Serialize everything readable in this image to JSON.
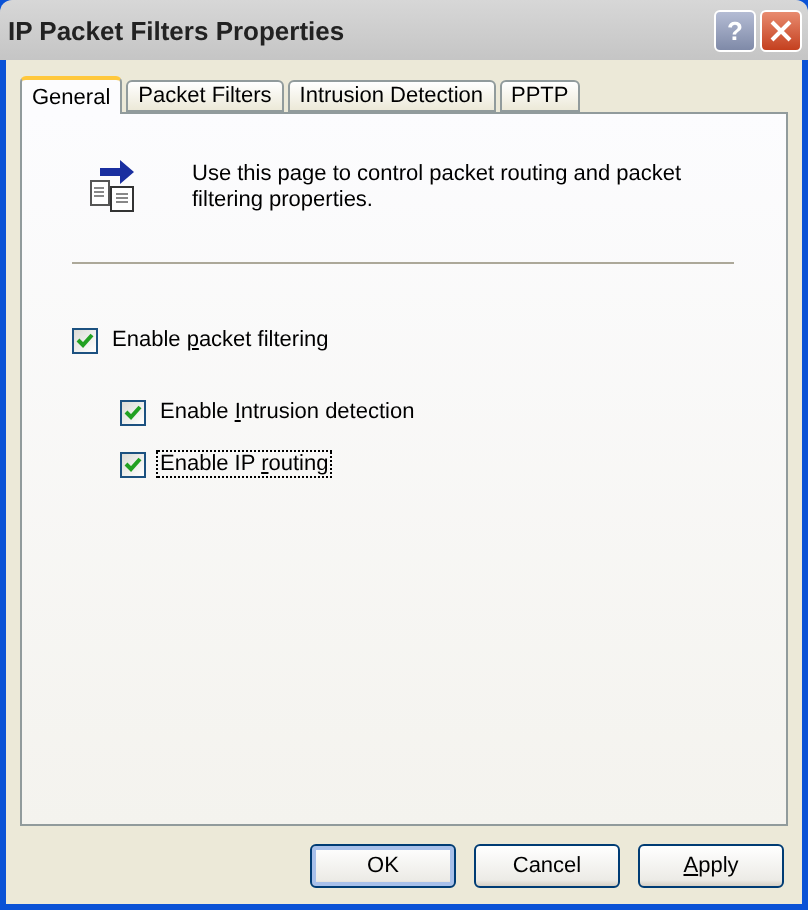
{
  "window": {
    "title": "IP Packet Filters Properties",
    "title_buttons": [
      {
        "kind": "help",
        "label": "?"
      },
      {
        "kind": "close"
      }
    ]
  },
  "tabs": [
    {
      "label": "General",
      "selected": true
    },
    {
      "label": "Packet Filters",
      "selected": false
    },
    {
      "label": "Intrusion Detection",
      "selected": false
    },
    {
      "label": "PPTP",
      "selected": false
    }
  ],
  "description": "Use this page to control packet routing and packet filtering properties.",
  "options": [
    {
      "label": {
        "before": "Enable ",
        "key": "p",
        "after": "acket filtering"
      },
      "checked": true,
      "focused": false,
      "children": [
        {
          "label": {
            "before": "Enable ",
            "key": "I",
            "after": "ntrusion detection"
          },
          "checked": true,
          "focused": false
        },
        {
          "label": {
            "before": "Enable IP ",
            "key": "r",
            "after": "outing"
          },
          "checked": true,
          "focused": true
        }
      ]
    }
  ],
  "buttons": [
    {
      "label": {
        "before": "OK"
      },
      "default": true
    },
    {
      "label": {
        "before": "Cancel"
      },
      "default": false
    },
    {
      "label": {
        "key": "A",
        "after": "pply"
      },
      "default": false
    }
  ]
}
